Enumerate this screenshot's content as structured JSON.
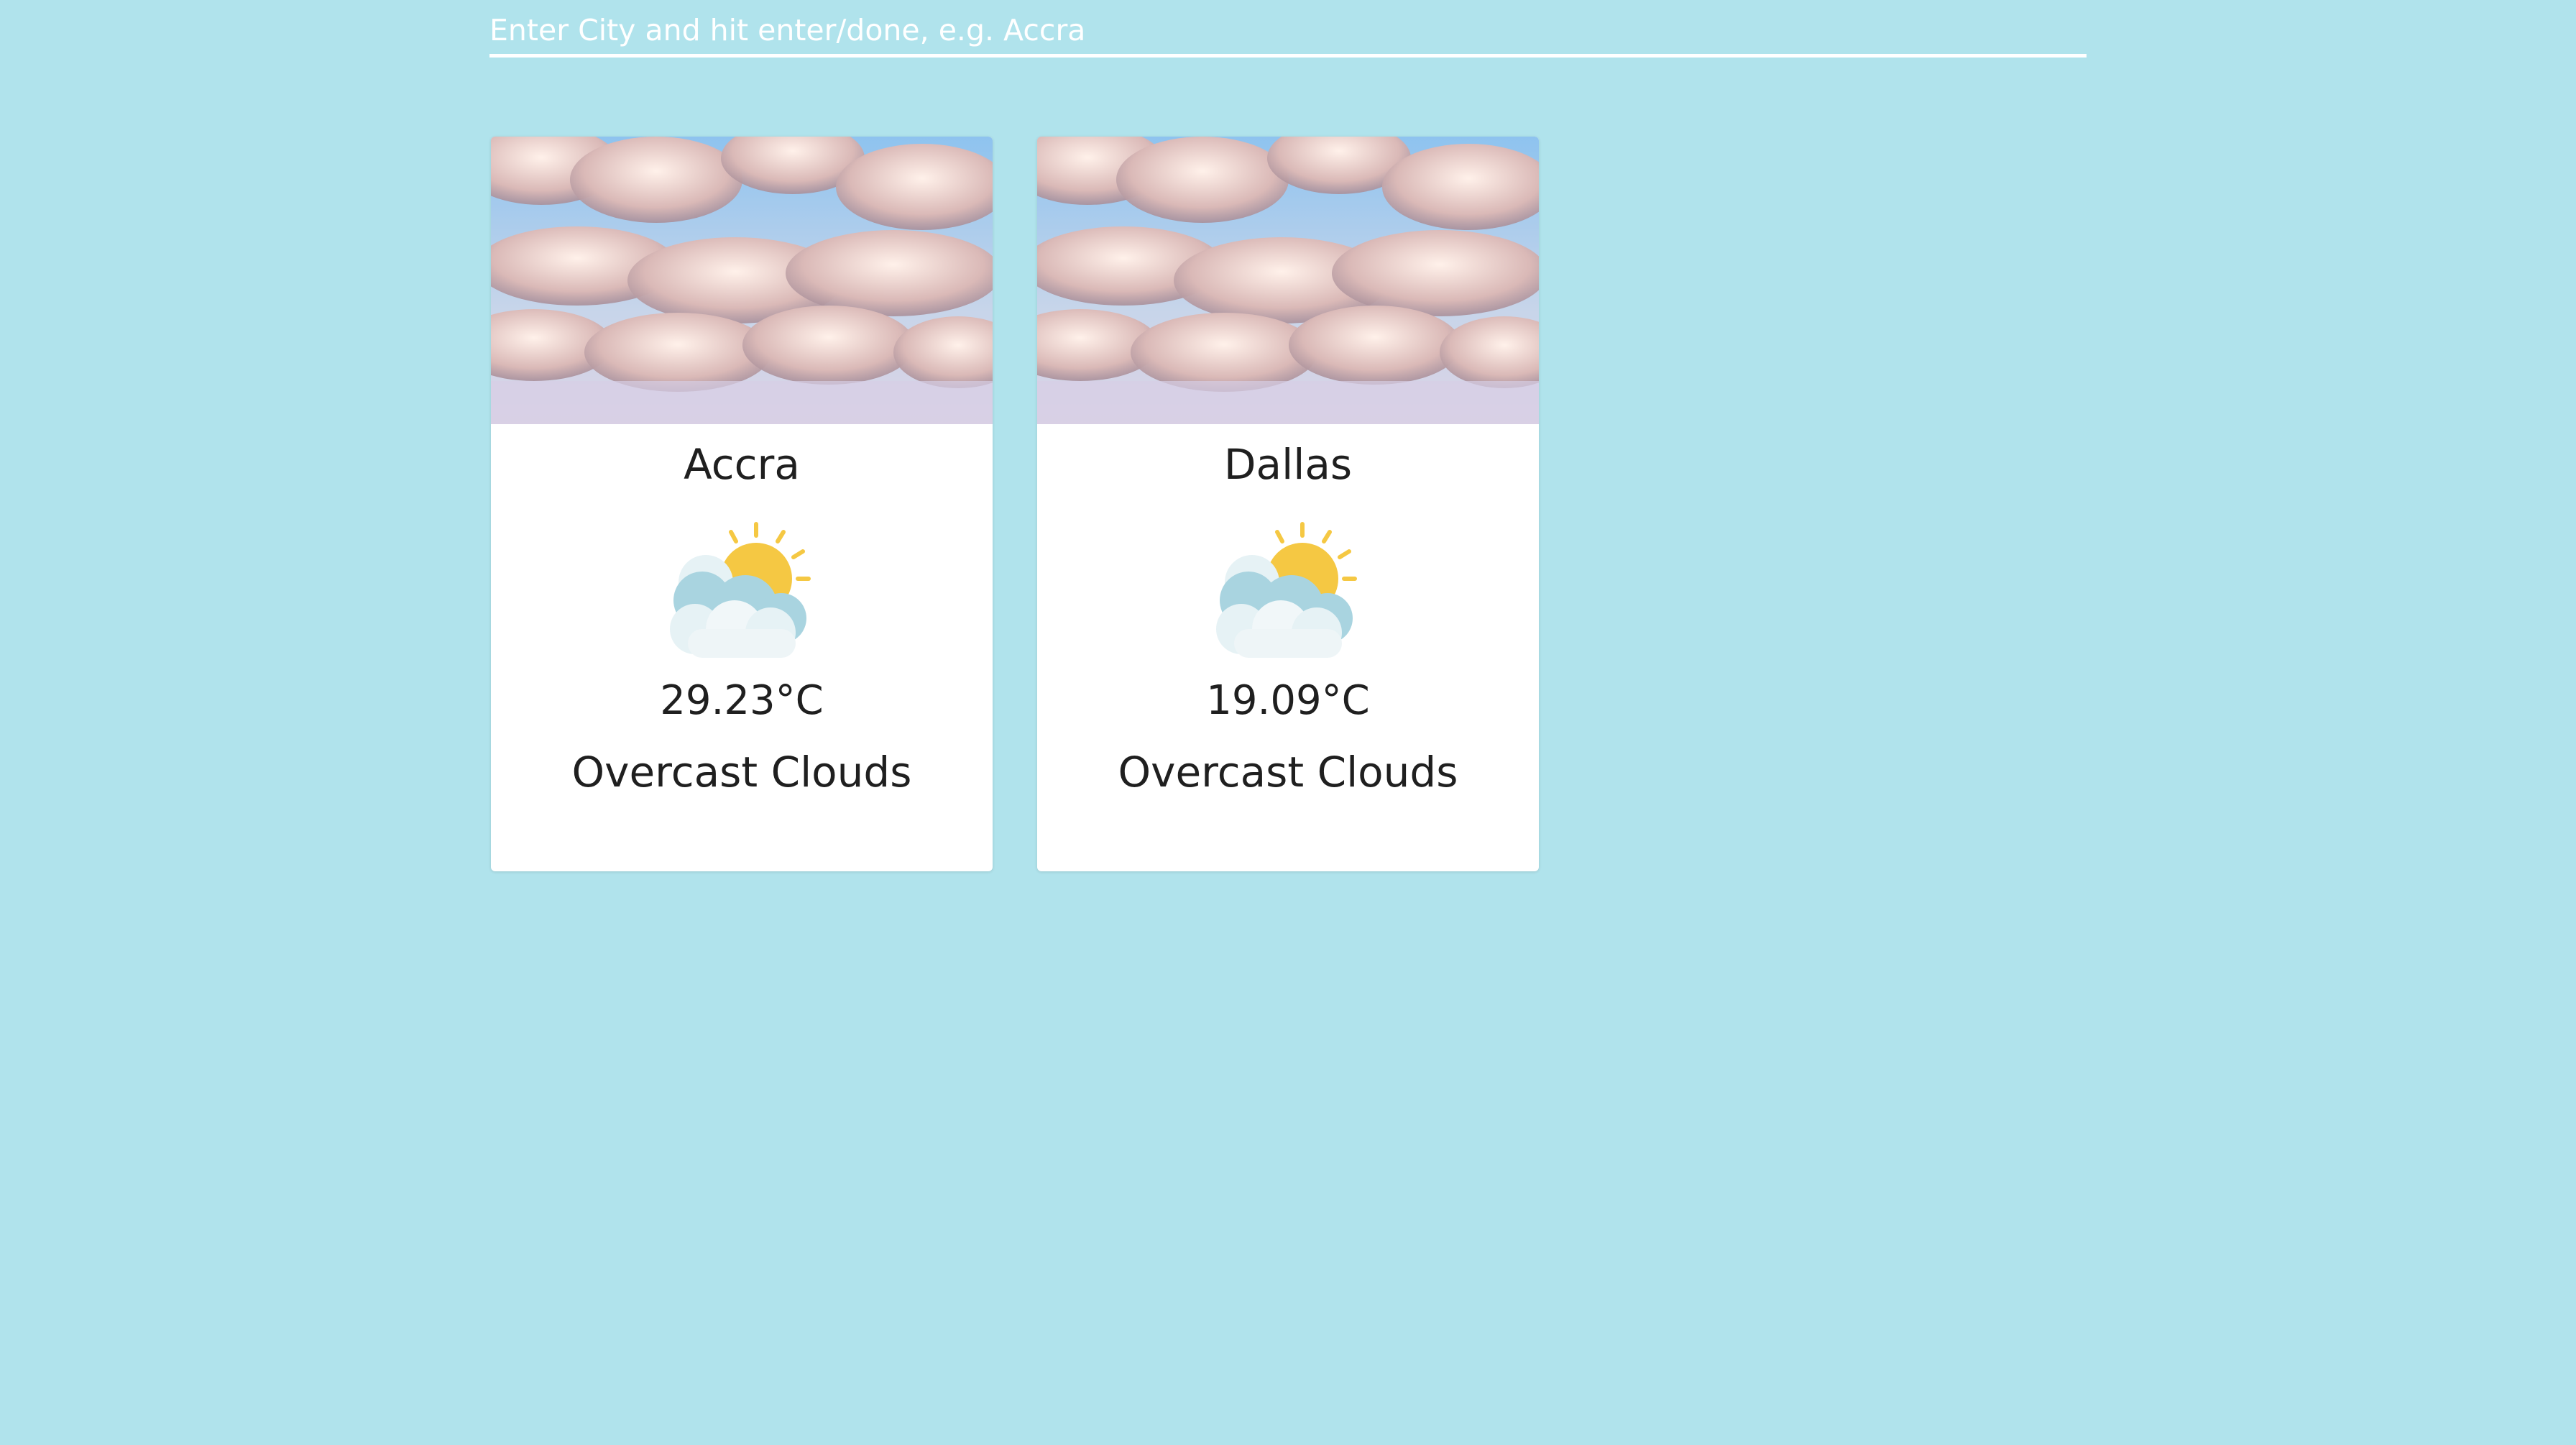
{
  "search": {
    "placeholder": "Enter City and hit enter/done, e.g. Accra",
    "value": ""
  },
  "cards": [
    {
      "city": "Accra",
      "temperature": "29.23°C",
      "description": "Overcast Clouds",
      "icon": "sun-behind-cloud-icon",
      "image": "cloudy-sky-photo"
    },
    {
      "city": "Dallas",
      "temperature": "19.09°C",
      "description": "Overcast Clouds",
      "icon": "sun-behind-cloud-icon",
      "image": "cloudy-sky-photo"
    }
  ],
  "colors": {
    "background": "#b0e3ec",
    "card": "#ffffff",
    "text": "#1f1f1f",
    "sun": "#f7b733",
    "cloud": "#e7f3f6",
    "cloud_shadow": "#a9d4e0"
  }
}
